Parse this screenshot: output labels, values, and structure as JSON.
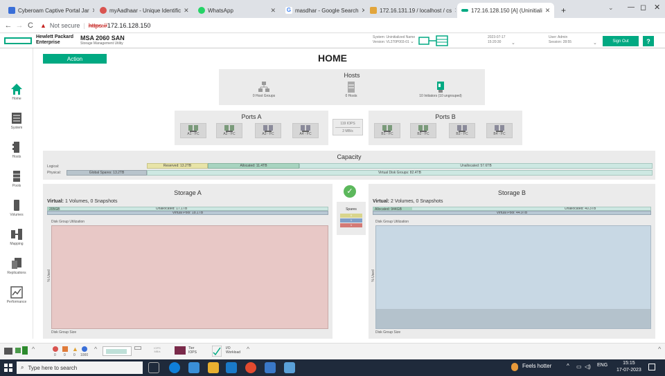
{
  "browser": {
    "tabs": [
      {
        "label": "Cyberoam Captive Portal Jar"
      },
      {
        "label": "myAadhaar - Unique Identific"
      },
      {
        "label": "WhatsApp"
      },
      {
        "label": "masdhar - Google Search"
      },
      {
        "label": "172.16.131.19 / localhost / cs"
      },
      {
        "label": "172.16.128.150 [A] (Uninitiali"
      }
    ],
    "not_secure": "Not secure",
    "url_scheme": "https://",
    "url_host": "172.16.128.150",
    "new_tab": "+"
  },
  "header": {
    "brand_line1": "Hewlett Packard",
    "brand_line2": "Enterprise",
    "product": "MSA 2060 SAN",
    "product_sub": "Storage Management Utility",
    "system_name_label": "System: Uninitialized Name",
    "version_label": "Version: VL270P003-01",
    "date": "2023-07-17",
    "time": "15:20:30",
    "user": "User: Admin",
    "session": "Session: 28:55",
    "sign_out": "Sign Out",
    "help": "?"
  },
  "sidebar": {
    "items": [
      {
        "label": "Home",
        "icon": "home-icon"
      },
      {
        "label": "System",
        "icon": "system-icon"
      },
      {
        "label": "Hosts",
        "icon": "hosts-icon"
      },
      {
        "label": "Pools",
        "icon": "pools-icon"
      },
      {
        "label": "Volumes",
        "icon": "volumes-icon"
      },
      {
        "label": "Mapping",
        "icon": "mapping-icon"
      },
      {
        "label": "Replications",
        "icon": "replications-icon"
      },
      {
        "label": "Performance",
        "icon": "performance-icon"
      }
    ]
  },
  "main": {
    "action": "Action",
    "title": "HOME",
    "hosts": {
      "title": "Hosts",
      "host_groups": "0 Host Groups",
      "hosts": "0 Hosts",
      "initiators": "10 Initiators (10 ungrouped)"
    },
    "ports_a": {
      "title": "Ports A",
      "ports": [
        "A1 - FC",
        "A2 - FC",
        "A3 - FC",
        "A4 - FC"
      ]
    },
    "ports_b": {
      "title": "Ports B",
      "ports": [
        "B1 - FC",
        "B2 - FC",
        "B3 - FC",
        "B4 - FC"
      ]
    },
    "throughput": {
      "iops": "119 IOPS",
      "rate": "2 MB/s"
    },
    "capacity": {
      "title": "Capacity",
      "logical_label": "Logical:",
      "physical_label": "Physical:",
      "reserved": "Reserved: 13.2TB",
      "allocated": "Allocated: 11.4TB",
      "unallocated": "Unallocated: 57.6TB",
      "global_spares": "Global Spares: 13.2TB",
      "virtual_disk_groups": "Virtual Disk Groups: 82.4TB"
    },
    "storage_a": {
      "title": "Storage A",
      "virtual_label": "Virtual:",
      "virtual_info": "1 Volumes, 0 Snapshots",
      "allocated": "205GB",
      "unallocated": "Unallocated: 17.1TB",
      "pool": "Virtual Pool: 18.1TB",
      "dg_util": "Disk Group Utilization",
      "y_label": "% Used",
      "x_label": "Disk Group Size"
    },
    "storage_b": {
      "title": "Storage B",
      "virtual_label": "Virtual:",
      "virtual_info": "2 Volumes, 0 Snapshots",
      "allocated": "Allocated: 944GB",
      "unallocated": "Unallocated: 40.3TB",
      "pool": "Virtual Pool: 44.9TB",
      "dg_util": "Disk Group Utilization",
      "y_label": "% Used",
      "x_label": "Disk Group Size"
    },
    "spares": {
      "label": "Spares",
      "values": [
        "0",
        "1",
        "1"
      ]
    }
  },
  "statusbar": {
    "counts": [
      "0",
      "0",
      "0",
      "1000"
    ],
    "iops_label": "IOPS",
    "mbs_label": "MB/s",
    "tier_label": "Tier",
    "tier_sub": "IOPS",
    "io_label": "I/O",
    "io_sub": "Workload"
  },
  "taskbar": {
    "search_placeholder": "Type here to search",
    "weather": "Feels hotter",
    "lang": "ENG",
    "time": "15:15",
    "date": "17-07-2023"
  },
  "colors": {
    "accent": "#01a982",
    "storage_a_fill": "#e8c8c6",
    "storage_b_fill": "#c8d8e4",
    "capacity_teal": "#bfe0d8",
    "reserved_yellow": "#e8e4a8",
    "spare_yellow": "#d9d58c",
    "spare_blue": "#7f9fc8",
    "spare_red": "#d37a76"
  }
}
